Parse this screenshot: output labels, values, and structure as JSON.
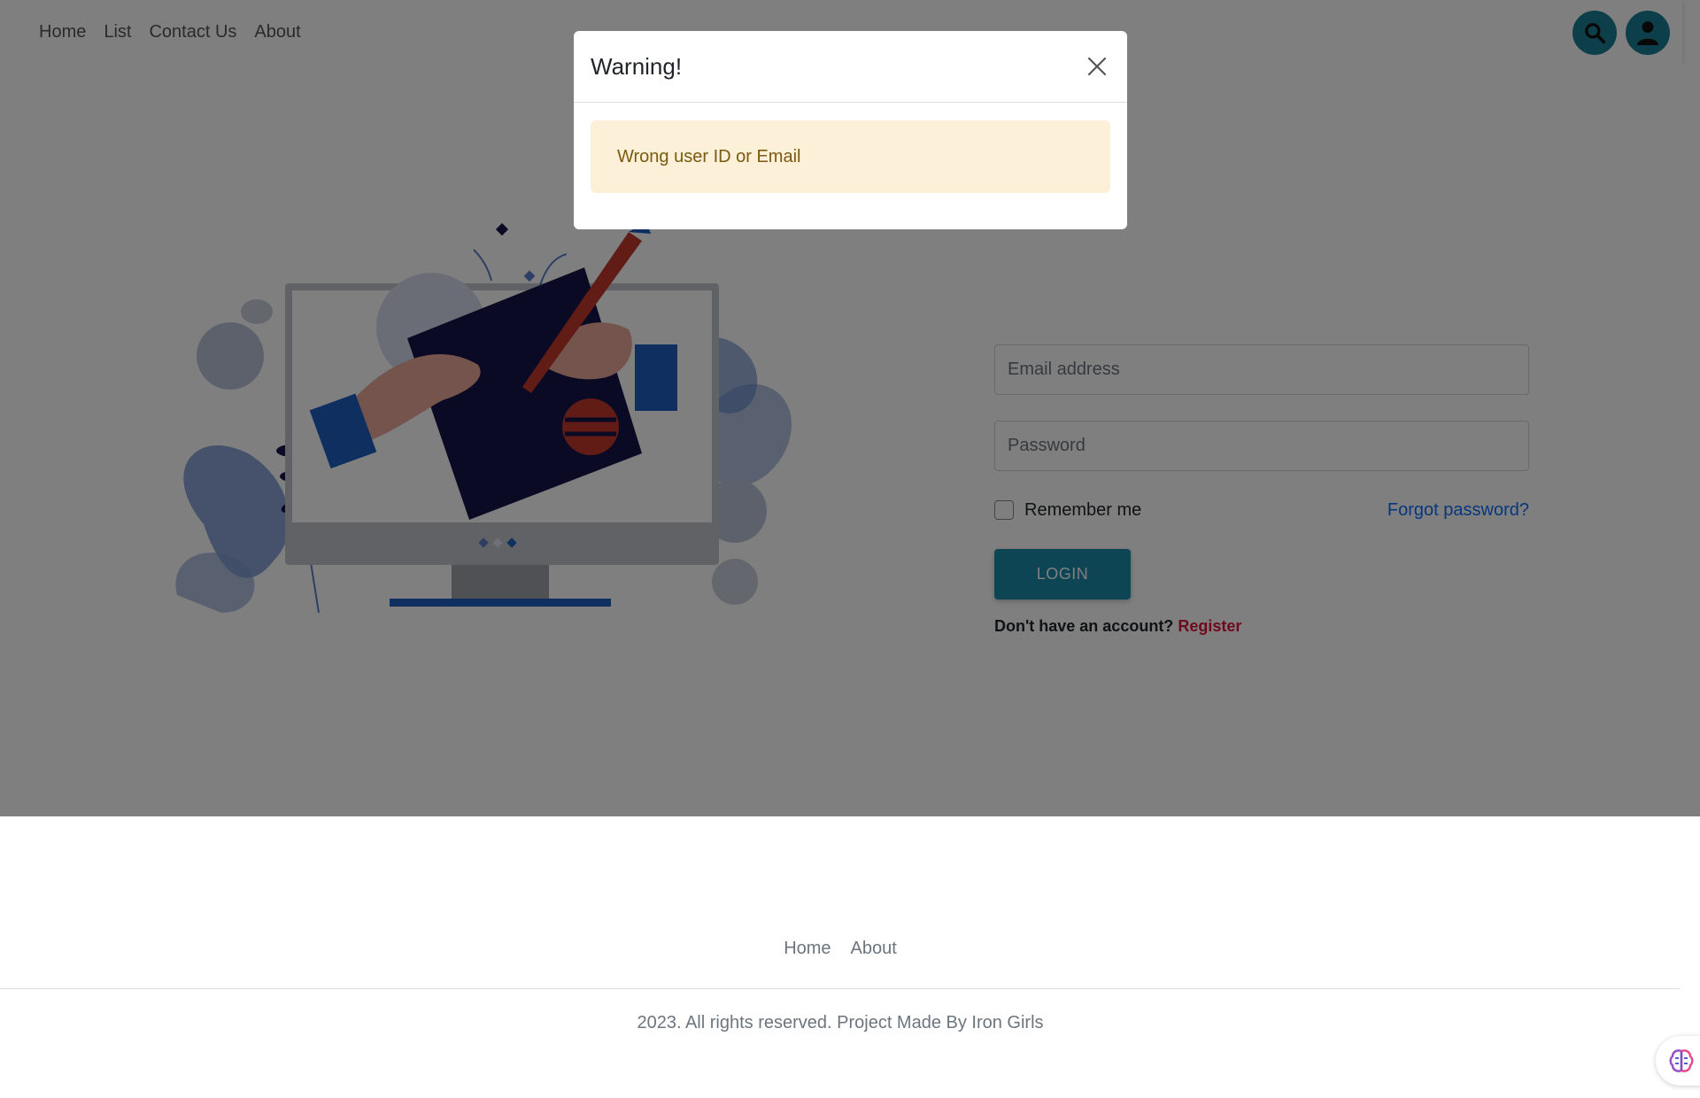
{
  "navbar": {
    "links": [
      "Home",
      "List",
      "Contact Us",
      "About"
    ],
    "icons": [
      "search-icon",
      "user-icon"
    ]
  },
  "login": {
    "email_placeholder": "Email address",
    "password_placeholder": "Password",
    "remember_label": "Remember me",
    "remember_checked": false,
    "forgot_label": "Forgot password?",
    "login_label": "LOGIN",
    "signup_prompt": "Don't have an account?",
    "register_label": "Register"
  },
  "footer": {
    "links": [
      "Home",
      "About"
    ],
    "copyright": "2023. All rights reserved. Project Made By Iron Girls"
  },
  "modal": {
    "title": "Warning!",
    "message": "Wrong user ID or Email"
  },
  "colors": {
    "accent": "#1b8bab",
    "link": "#0d6efd",
    "register": "#dc143c",
    "alert_bg": "#fdf0d9",
    "alert_text": "#7a5a10",
    "illustration_navy": "#14154a",
    "illustration_blue": "#1d5fbf"
  }
}
